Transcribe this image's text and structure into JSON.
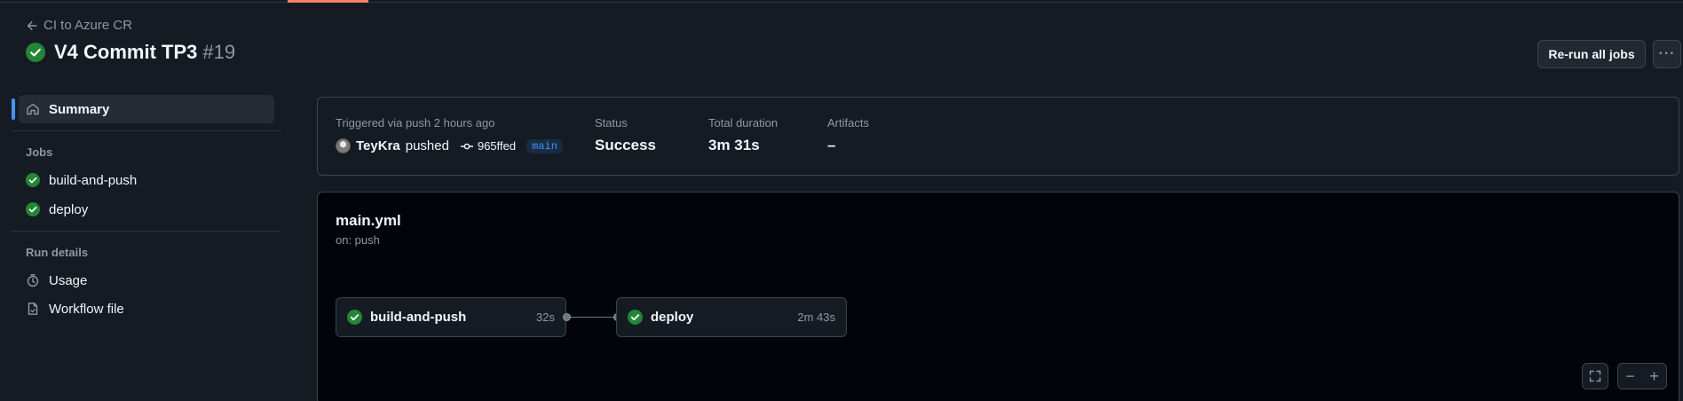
{
  "header": {
    "back_label": "CI to Azure CR",
    "run_title": "V4 Commit TP3",
    "run_number": "#19",
    "rerun_label": "Re-run all jobs",
    "more_label": "···"
  },
  "sidebar": {
    "summary_label": "Summary",
    "jobs_heading": "Jobs",
    "jobs": [
      {
        "label": "build-and-push",
        "status": "success"
      },
      {
        "label": "deploy",
        "status": "success"
      }
    ],
    "run_details_heading": "Run details",
    "details": [
      {
        "label": "Usage",
        "icon": "stopwatch-icon"
      },
      {
        "label": "Workflow file",
        "icon": "file-icon"
      }
    ]
  },
  "summary": {
    "trigger_text": "Triggered via push 2 hours ago",
    "pusher": "TeyKra",
    "pushed_word": "pushed",
    "commit_sha": "965ffed",
    "branch": "main",
    "status_label": "Status",
    "status_value": "Success",
    "duration_label": "Total duration",
    "duration_value": "3m 31s",
    "artifacts_label": "Artifacts",
    "artifacts_value": "–"
  },
  "workflow": {
    "file": "main.yml",
    "trigger": "on: push",
    "jobs": [
      {
        "name": "build-and-push",
        "duration": "32s"
      },
      {
        "name": "deploy",
        "duration": "2m 43s"
      }
    ],
    "zoom_out": "−",
    "zoom_in": "+"
  },
  "colors": {
    "success": "#238636",
    "accent": "#4493f8",
    "background": "#151b23",
    "graph_background": "#010409"
  }
}
